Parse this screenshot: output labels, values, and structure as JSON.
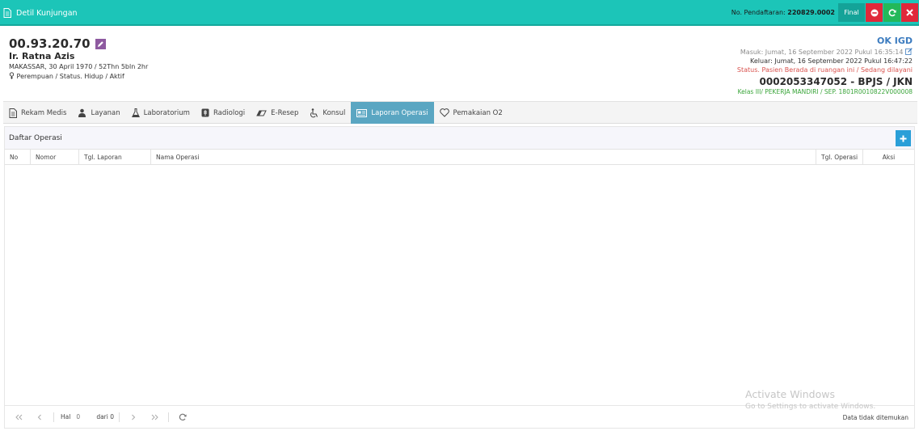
{
  "header": {
    "title": "Detil Kunjungan",
    "reg_label": "No. Pendaftaran:",
    "reg_value": "220829.0002",
    "final_label": "Final",
    "colors": {
      "bar": "#1cc5b8",
      "danger": "#e0283a",
      "success": "#23b85a"
    }
  },
  "patient": {
    "rm_no": "00.93.20.70",
    "name": "Ir. Ratna Azis",
    "birth": "MAKASSAR, 30 April 1970 / 52Thn 5bln 2hr",
    "gender_status": "Perempuan / Status. Hidup / Aktif"
  },
  "visit": {
    "unit": "OK IGD",
    "masuk": "Masuk: Jumat, 16 September 2022 Pukul 16:35:14",
    "keluar": "Keluar: Jumat, 16 September 2022 Pukul 16:47:22",
    "status": "Status. Pasien Berada di ruangan ini / Sedang dilayani",
    "bpjs": "0002053347052 - BPJS / JKN",
    "kelas": "Kelas III/ PEKERJA MANDIRI / SEP. 1801R0010822V000008"
  },
  "tabs": [
    {
      "label": "Rekam Medis",
      "icon": "document-icon"
    },
    {
      "label": "Layanan",
      "icon": "doctor-icon"
    },
    {
      "label": "Laboratorium",
      "icon": "flask-icon"
    },
    {
      "label": "Radiologi",
      "icon": "xray-icon"
    },
    {
      "label": "E-Resep",
      "icon": "pill-icon"
    },
    {
      "label": "Konsul",
      "icon": "wheelchair-icon"
    },
    {
      "label": "Laporan Operasi",
      "icon": "report-icon",
      "active": true
    },
    {
      "label": "Pemakaian O2",
      "icon": "heart-icon"
    }
  ],
  "panel": {
    "title": "Daftar Operasi",
    "columns": [
      "No",
      "Nomor",
      "Tgl. Laporan",
      "Nama Operasi",
      "Tgl. Operasi",
      "Aksi"
    ]
  },
  "pagination": {
    "page_label": "Hal",
    "page_value": "0",
    "of_label": "dari 0",
    "empty_message": "Data tidak ditemukan"
  },
  "watermark": {
    "line1": "Activate Windows",
    "line2": "Go to Settings to activate Windows."
  }
}
